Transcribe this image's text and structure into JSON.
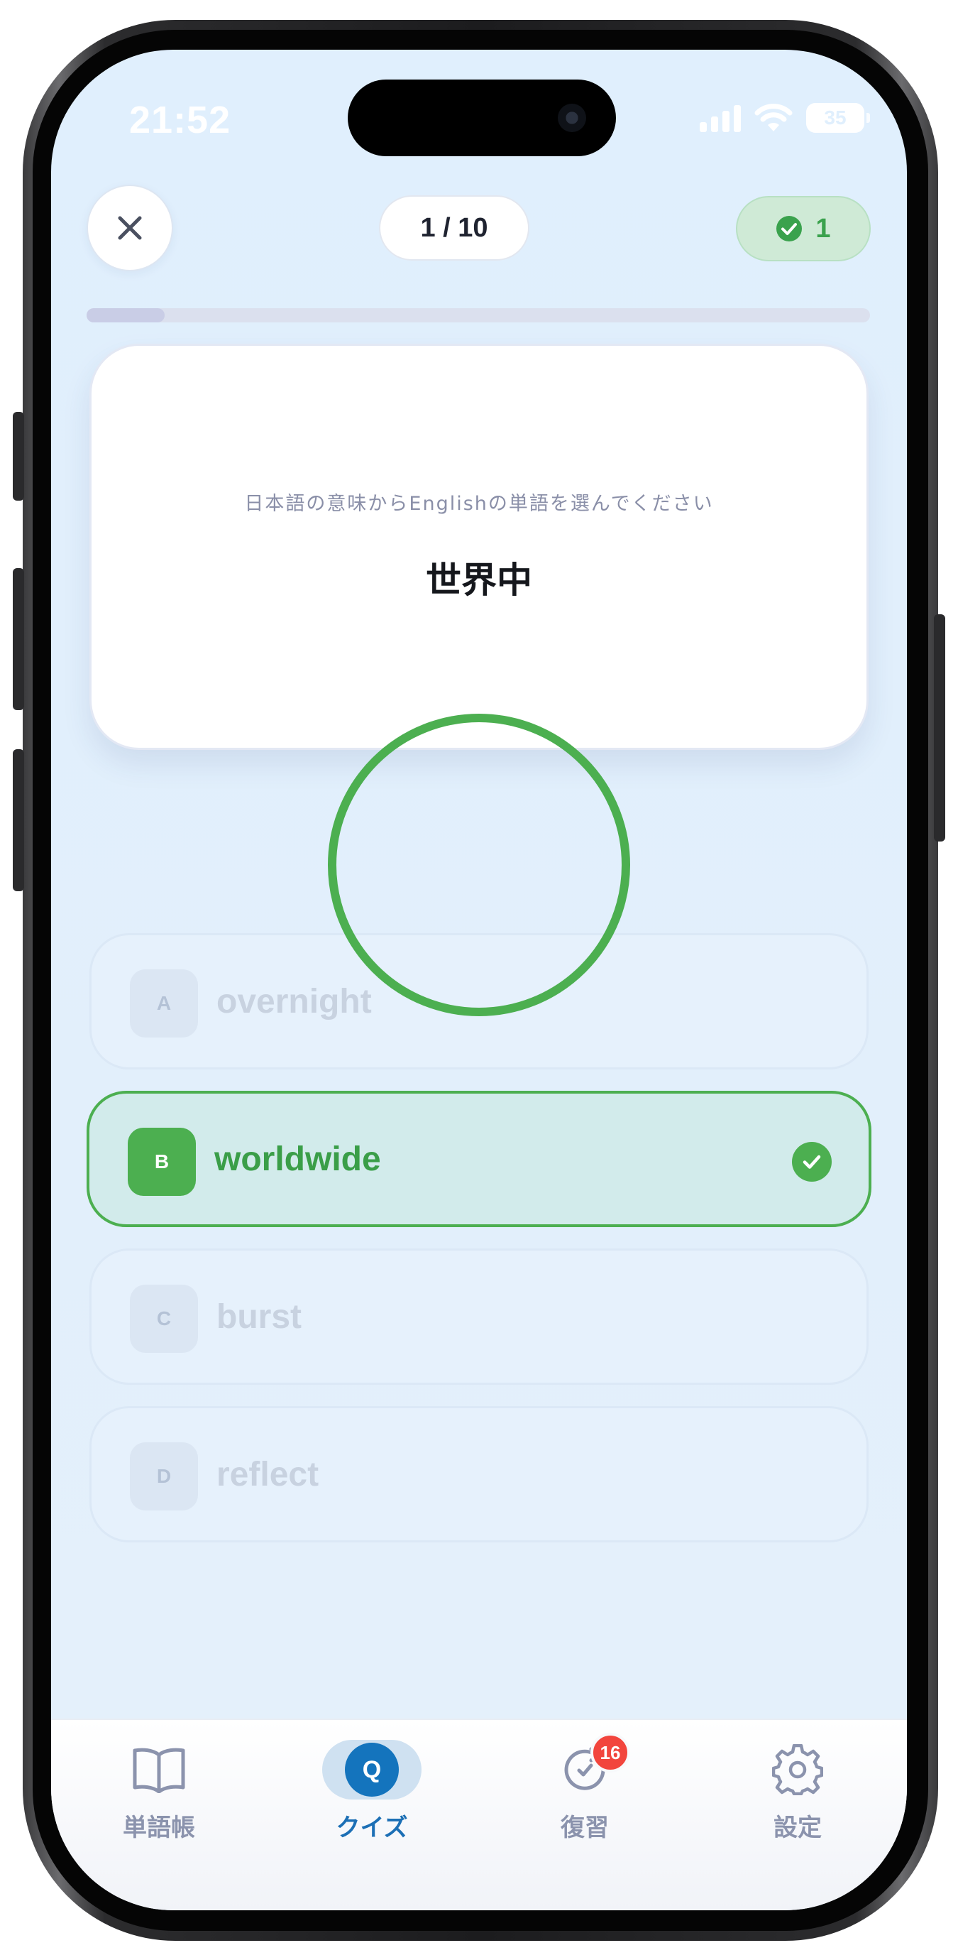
{
  "status_bar": {
    "time": "21:52",
    "battery": "35"
  },
  "header": {
    "progress": "1 / 10",
    "score": "1",
    "progress_fraction": 0.1
  },
  "question": {
    "instruction": "日本語の意味からEnglishの単語を選んでください",
    "word": "世界中"
  },
  "options": [
    {
      "letter": "A",
      "text": "overnight"
    },
    {
      "letter": "B",
      "text": "worldwide"
    },
    {
      "letter": "C",
      "text": "burst"
    },
    {
      "letter": "D",
      "text": "reflect"
    }
  ],
  "tabs": [
    {
      "label": "単語帳",
      "icon": "book-icon"
    },
    {
      "label": "クイズ",
      "icon": "quiz-icon",
      "icon_text": "Q"
    },
    {
      "label": "復習",
      "icon": "review-icon",
      "badge": "16"
    },
    {
      "label": "設定",
      "icon": "gear-icon"
    }
  ],
  "colors": {
    "correct": "#4caf50",
    "accent": "#1474bd",
    "badge": "#f2453d",
    "background": "#e0effd"
  }
}
